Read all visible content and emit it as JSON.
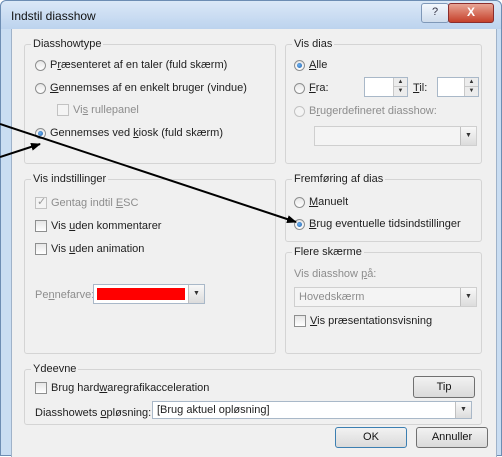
{
  "window": {
    "title": "Indstil diasshow",
    "help_label": "?",
    "close_label": "X"
  },
  "show_type": {
    "legend": "Diasshowtype",
    "opt1": {
      "pre": "P",
      "acc": "r",
      "post": "æsenteret af en taler (fuld skærm)"
    },
    "opt2": {
      "pre": "",
      "acc": "G",
      "post": "ennemses af en enkelt bruger (vindue)"
    },
    "scroll": {
      "pre": "Vi",
      "acc": "s",
      "post": " rullepanel"
    },
    "opt3": {
      "pre": "Gennemses ved ",
      "acc": "k",
      "post": "iosk (fuld skærm)"
    }
  },
  "slides": {
    "legend": "Vis dias",
    "all": {
      "pre": "",
      "acc": "A",
      "post": "lle"
    },
    "from": {
      "pre": "",
      "acc": "F",
      "post": "ra:"
    },
    "to": {
      "pre": "",
      "acc": "T",
      "post": "il:"
    },
    "custom": {
      "pre": "B",
      "acc": "r",
      "post": "ugerdefineret diasshow:"
    }
  },
  "options": {
    "legend": "Vis indstillinger",
    "loop": {
      "pre": "Gentag indtil ",
      "acc": "E",
      "post": "SC"
    },
    "narration": {
      "pre": "Vis ",
      "acc": "u",
      "post": "den kommentarer"
    },
    "animation": {
      "pre": "Vis ",
      "acc": "u",
      "post": "den animation"
    },
    "pen": {
      "pre": "Pe",
      "acc": "n",
      "post": "nefarve:"
    },
    "pen_color": "#ff0000"
  },
  "advance": {
    "legend": "Fremføring af dias",
    "manual": {
      "pre": "",
      "acc": "M",
      "post": "anuelt"
    },
    "timings": {
      "pre": "",
      "acc": "B",
      "post": "rug eventuelle tidsindstillinger"
    }
  },
  "monitors": {
    "legend": "Flere skærme",
    "show_on": {
      "pre": "Vis diasshow ",
      "acc": "p",
      "post": "å:"
    },
    "monitor_value": "Hovedskærm",
    "presenter": {
      "pre": "",
      "acc": "V",
      "post": "is præsentationsvisning"
    }
  },
  "performance": {
    "legend": "Ydeevne",
    "hw": {
      "pre": "Brug hard",
      "acc": "w",
      "post": "aregrafikacceleration"
    },
    "tip_label": "Tip",
    "res": {
      "pre": "Diasshowets ",
      "acc": "o",
      "post": "pløsning:"
    },
    "res_value": "[Brug aktuel opløsning]"
  },
  "buttons": {
    "ok": "OK",
    "cancel": "Annuller"
  }
}
